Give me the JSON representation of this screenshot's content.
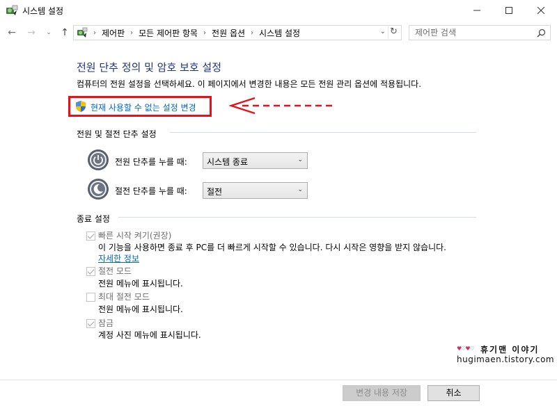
{
  "window": {
    "title": "시스템 설정",
    "icons": {
      "app": "power-options-icon",
      "minimize": "minimize-icon",
      "maximize": "maximize-icon",
      "close": "close-icon"
    }
  },
  "nav": {
    "breadcrumbs": [
      "제어판",
      "모든 제어판 항목",
      "전원 옵션",
      "시스템 설정"
    ],
    "search_placeholder": "제어판 검색"
  },
  "content": {
    "title": "전원 단추 정의 및 암호 보호 설정",
    "description": "컴퓨터의 전원 설정을 선택하세요. 이 페이지에서 변경한 내용은 모든 전원 관리 옵션에 적용됩니다.",
    "change_link": "현재 사용할 수 없는 설정 변경",
    "highlight_color": "#e8101a",
    "buttons_section": {
      "title": "전원 및 절전 단추 설정",
      "power_button_label": "전원 단추를 누를 때:",
      "power_button_value": "시스템 종료",
      "sleep_button_label": "절전 단추를 누를 때:",
      "sleep_button_value": "절전"
    },
    "shutdown_section": {
      "title": "종료 설정",
      "options": [
        {
          "label": "빠른 시작 켜기(권장)",
          "checked": true,
          "description": "이 기능을 사용하면 종료 후 PC를 더 빠르게 시작할 수 있습니다. 다시 시작은 영향을 받지 않습니다.",
          "link": "자세한 정보"
        },
        {
          "label": "절전 모드",
          "checked": true,
          "description": "전원 메뉴에 표시됩니다."
        },
        {
          "label": "최대 절전 모드",
          "checked": false,
          "description": "전원 메뉴에 표시됩니다."
        },
        {
          "label": "잠금",
          "checked": true,
          "description": "계정 사진 메뉴에 표시됩니다."
        }
      ]
    }
  },
  "watermark": {
    "hearts": "♥♡♥♡",
    "name": "휴기맨 이야기",
    "url": "hugimaen.tistory.com"
  },
  "footer": {
    "save_label": "변경 내용 저장",
    "cancel_label": "취소"
  }
}
